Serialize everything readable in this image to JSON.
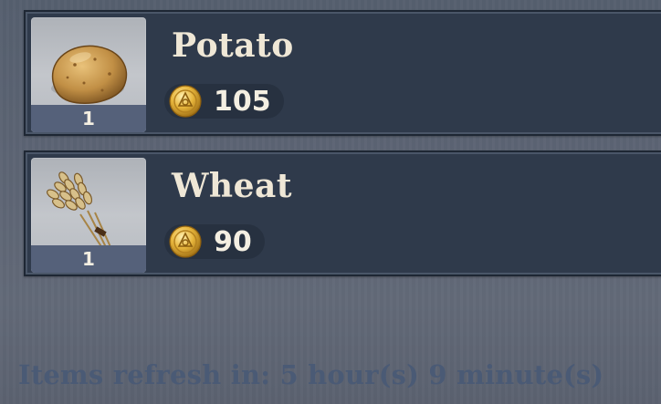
{
  "items": [
    {
      "name": "Potato",
      "count": "1",
      "price": "105",
      "icon": "potato-icon"
    },
    {
      "name": "Wheat",
      "count": "1",
      "price": "90",
      "icon": "wheat-icon"
    }
  ],
  "currency_icon": "mora-coin-icon",
  "refresh_text": "Items refresh in: 5 hour(s) 9 minute(s)",
  "colors": {
    "card_bg": "#2f3a4b",
    "name_text": "#efe7d6",
    "refresh_text": "#4a5a75",
    "coin_gold": "#e7b53b"
  }
}
